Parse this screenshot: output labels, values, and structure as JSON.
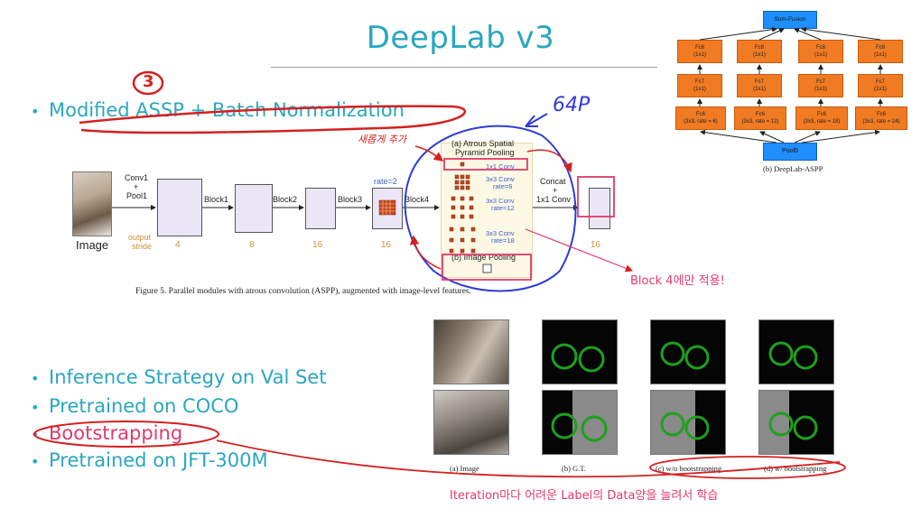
{
  "slide": {
    "title": "DeepLab v3",
    "bullets_top": [
      "Modified ASSP + Batch Normalization"
    ],
    "bullets_bottom": [
      "Inference Strategy on Val Set",
      "Pretrained on COCO",
      "Bootstrapping",
      "Pretrained on JFT-300M"
    ],
    "annotations": {
      "circled_number": "3",
      "note_64p": "64P",
      "note_korean_add": "새롭게 추가",
      "note_block4": "Block 4에만 적용!",
      "note_iteration": "Iteration마다 어려운 Label의 Data양을 늘려서 학습"
    }
  },
  "figure5": {
    "caption": "Figure 5. Parallel modules with atrous convolution (ASPP), augmented with image-level features.",
    "image_label": "Image",
    "conv1": "Conv1",
    "plus": "+",
    "pool1": "Pool1",
    "block1": "Block1",
    "block2": "Block2",
    "block3": "Block3",
    "block4": "Block4",
    "rate2": "rate=2",
    "output_stride": "output",
    "output_stride2": "stride",
    "strides": [
      "4",
      "8",
      "16",
      "16",
      "16"
    ],
    "aspp_title": "(a) Atrous Spatial",
    "aspp_title2": "Pyramid Pooling",
    "conv_1x1": "1x1 Conv",
    "conv_3x3_6": "3x3 Conv",
    "rate6": "rate=6",
    "conv_3x3_12": "3x3 Conv",
    "rate12": "rate=12",
    "conv_3x3_18": "3x3 Conv",
    "rate18": "rate=18",
    "image_pooling": "(b) Image Pooling",
    "concat": "Concat",
    "concat_plus": "+",
    "concat_conv": "1x1 Conv"
  },
  "deeplab_aspp": {
    "caption": "(b) DeepLab-ASPP",
    "sum_fusion": "Sum-Fusion",
    "pool5": "Pool5",
    "fc8": "Fc8",
    "fc7": "Fc7",
    "fc6": "Fc6",
    "k1x1": "(1x1)",
    "fc6_params": [
      "(3x3, rate = 6)",
      "(3x3, rate = 12)",
      "(3x3, rate = 18)",
      "(3x3, rate = 24)"
    ]
  },
  "bootstrap_figure": {
    "captions": [
      "(a) Image",
      "(b) G.T.",
      "(c) w/o bootstrapping",
      "(d) w/ bootstrapping"
    ]
  },
  "colors": {
    "title": "#2aa6c0",
    "annotation_red": "#d42020",
    "annotation_pink": "#e03a6a",
    "annotation_blue": "#2f3bd6",
    "fc_orange": "#f07b22",
    "node_blue": "#1f8fff"
  }
}
